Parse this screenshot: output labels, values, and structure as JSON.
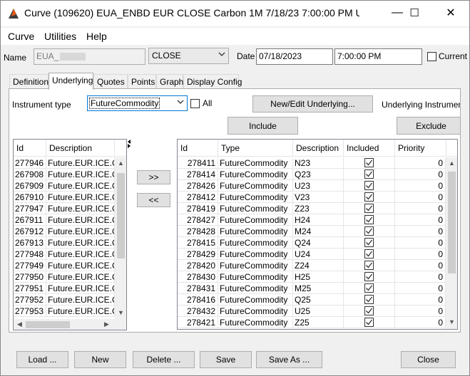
{
  "window": {
    "title": "Curve (109620) EUA_ENBD EUR CLOSE Carbon 1M 7/18/23 7:00:00 PM U...",
    "controls": {
      "minimize": "—",
      "maximize": "☐",
      "close": "✕"
    }
  },
  "menu": [
    "Curve",
    "Utilities",
    "Help"
  ],
  "header": {
    "name_label": "Name",
    "name_value": "EUA_",
    "close_value": "CLOSE",
    "date_label": "Date",
    "date_value": "07/18/2023",
    "time_value": "7:00:00 PM",
    "current_label": "Current"
  },
  "tabs": [
    "Definition",
    "Underlying",
    "Quotes",
    "Points",
    "Graph",
    "Display Config"
  ],
  "underlying": {
    "instrument_type_label": "Instrument type",
    "instrument_type_value": "FutureCommodity",
    "all_label": "All",
    "new_edit_button": "New/Edit Underlying...",
    "underlying_instruments_label": "Underlying Instrument",
    "include_button": "Include",
    "exclude_button": "Exclude",
    "move_right_button": ">>",
    "move_left_button": "<<"
  },
  "left_table": {
    "columns": [
      "Id",
      "Description"
    ],
    "rows": [
      [
        "277946",
        "Future.EUR.ICE.Ca"
      ],
      [
        "267908",
        "Future.EUR.ICE.Ca"
      ],
      [
        "267909",
        "Future.EUR.ICE.Ca"
      ],
      [
        "267910",
        "Future.EUR.ICE.Ca"
      ],
      [
        "277947",
        "Future.EUR.ICE.Ca"
      ],
      [
        "267911",
        "Future.EUR.ICE.Ca"
      ],
      [
        "267912",
        "Future.EUR.ICE.Ca"
      ],
      [
        "267913",
        "Future.EUR.ICE.Ca"
      ],
      [
        "277948",
        "Future.EUR.ICE.Ca"
      ],
      [
        "277949",
        "Future.EUR.ICE.Ca"
      ],
      [
        "277950",
        "Future.EUR.ICE.Ca"
      ],
      [
        "277951",
        "Future.EUR.ICE.Ca"
      ],
      [
        "277952",
        "Future.EUR.ICE.Ca"
      ],
      [
        "277953",
        "Future.EUR.ICE.Ca"
      ]
    ]
  },
  "right_table": {
    "columns": [
      "Id",
      "Type",
      "Description",
      "Included",
      "Priority"
    ],
    "rows": [
      [
        "278411",
        "FutureCommodity",
        "N23",
        "0"
      ],
      [
        "278414",
        "FutureCommodity",
        "Q23",
        "0"
      ],
      [
        "278426",
        "FutureCommodity",
        "U23",
        "0"
      ],
      [
        "278412",
        "FutureCommodity",
        "V23",
        "0"
      ],
      [
        "278419",
        "FutureCommodity",
        "Z23",
        "0"
      ],
      [
        "278427",
        "FutureCommodity",
        "H24",
        "0"
      ],
      [
        "278428",
        "FutureCommodity",
        "M24",
        "0"
      ],
      [
        "278415",
        "FutureCommodity",
        "Q24",
        "0"
      ],
      [
        "278429",
        "FutureCommodity",
        "U24",
        "0"
      ],
      [
        "278420",
        "FutureCommodity",
        "Z24",
        "0"
      ],
      [
        "278430",
        "FutureCommodity",
        "H25",
        "0"
      ],
      [
        "278431",
        "FutureCommodity",
        "M25",
        "0"
      ],
      [
        "278416",
        "FutureCommodity",
        "Q25",
        "0"
      ],
      [
        "278432",
        "FutureCommodity",
        "U25",
        "0"
      ],
      [
        "278421",
        "FutureCommodity",
        "Z25",
        "0"
      ]
    ]
  },
  "footer": {
    "load": "Load ...",
    "new": "New",
    "delete": "Delete ...",
    "save": "Save",
    "save_as": "Save As ...",
    "close": "Close"
  },
  "colors": {
    "accent": "#e05a1a",
    "icon_dark": "#3b3b3b"
  }
}
